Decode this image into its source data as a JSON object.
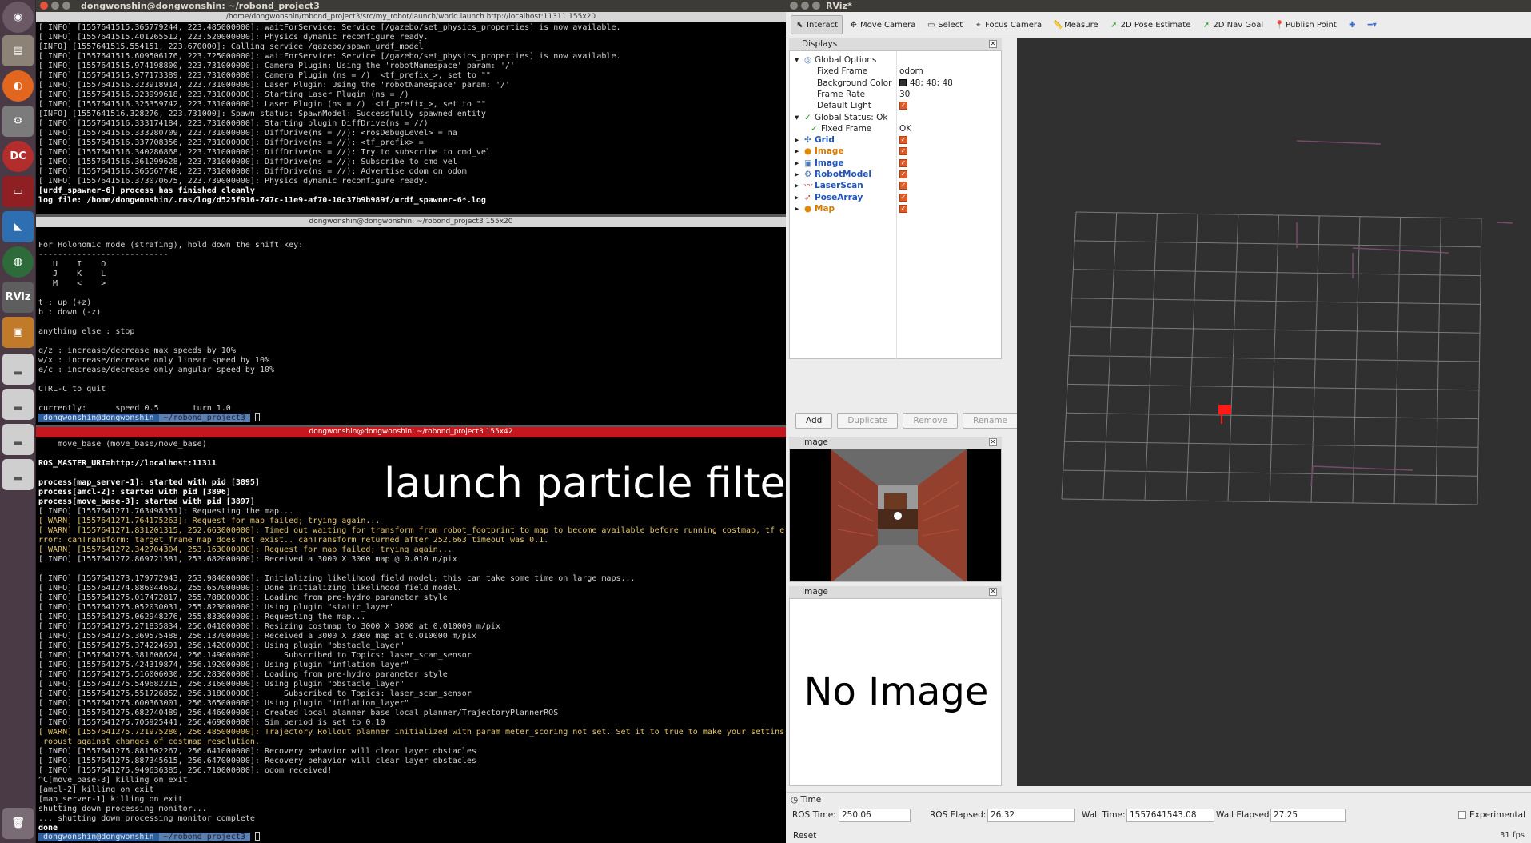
{
  "terminal": {
    "title": "dongwonshin@dongwonshin: ~/robond_project3",
    "pane1_tab": "/home/dongwonshin/robond_project3/src/my_robot/launch/world.launch http://localhost:11311 155x20",
    "pane1_lines": [
      {
        "t": "[ INFO] [1557641515.365779244, 223.485000000]: waitForService: Service [/gazebo/set_physics_properties] is now available.",
        "c": ""
      },
      {
        "t": "[ INFO] [1557641515.401265512, 223.520000000]: Physics dynamic reconfigure ready.",
        "c": ""
      },
      {
        "t": "[INFO] [1557641515.554151, 223.670000]: Calling service /gazebo/spawn_urdf_model",
        "c": ""
      },
      {
        "t": "[ INFO] [1557641515.609506176, 223.725000000]: waitForService: Service [/gazebo/set_physics_properties] is now available.",
        "c": ""
      },
      {
        "t": "[ INFO] [1557641515.974198800, 223.731000000]: Camera Plugin: Using the 'robotNamespace' param: '/'",
        "c": ""
      },
      {
        "t": "[ INFO] [1557641515.977173389, 223.731000000]: Camera Plugin (ns = /)  <tf_prefix_>, set to \"\"",
        "c": ""
      },
      {
        "t": "[ INFO] [1557641516.323918914, 223.731000000]: Laser Plugin: Using the 'robotNamespace' param: '/'",
        "c": ""
      },
      {
        "t": "[ INFO] [1557641516.323999618, 223.731000000]: Starting Laser Plugin (ns = /)",
        "c": ""
      },
      {
        "t": "[ INFO] [1557641516.325359742, 223.731000000]: Laser Plugin (ns = /)  <tf_prefix_>, set to \"\"",
        "c": ""
      },
      {
        "t": "[INFO] [1557641516.328276, 223.731000]: Spawn status: SpawnModel: Successfully spawned entity",
        "c": ""
      },
      {
        "t": "[ INFO] [1557641516.333174184, 223.731000000]: Starting plugin DiffDrive(ns = //)",
        "c": ""
      },
      {
        "t": "[ INFO] [1557641516.333280709, 223.731000000]: DiffDrive(ns = //): <rosDebugLevel> = na",
        "c": ""
      },
      {
        "t": "[ INFO] [1557641516.337708356, 223.731000000]: DiffDrive(ns = //): <tf_prefix> =",
        "c": ""
      },
      {
        "t": "[ INFO] [1557641516.340286868, 223.731000000]: DiffDrive(ns = //): Try to subscribe to cmd_vel",
        "c": ""
      },
      {
        "t": "[ INFO] [1557641516.361299628, 223.731000000]: DiffDrive(ns = //): Subscribe to cmd_vel",
        "c": ""
      },
      {
        "t": "[ INFO] [1557641516.365567748, 223.731000000]: DiffDrive(ns = //): Advertise odom on odom",
        "c": ""
      },
      {
        "t": "[ INFO] [1557641516.373070675, 223.739000000]: Physics dynamic reconfigure ready.",
        "c": ""
      },
      {
        "t": "[urdf_spawner-6] process has finished cleanly",
        "c": "b"
      },
      {
        "t": "log file: /home/dongwonshin/.ros/log/d525f916-747c-11e9-af70-10c37b9b989f/urdf_spawner-6*.log",
        "c": "b"
      }
    ],
    "pane2_tab": "dongwonshin@dongwonshin: ~/robond_project3 155x20",
    "pane2_lines": [
      {
        "t": "For Holonomic mode (strafing), hold down the shift key:",
        "c": ""
      },
      {
        "t": "---------------------------",
        "c": ""
      },
      {
        "t": "   U    I    O",
        "c": ""
      },
      {
        "t": "   J    K    L",
        "c": ""
      },
      {
        "t": "   M    <    >",
        "c": ""
      },
      {
        "t": "",
        "c": ""
      },
      {
        "t": "t : up (+z)",
        "c": ""
      },
      {
        "t": "b : down (-z)",
        "c": ""
      },
      {
        "t": "",
        "c": ""
      },
      {
        "t": "anything else : stop",
        "c": ""
      },
      {
        "t": "",
        "c": ""
      },
      {
        "t": "q/z : increase/decrease max speeds by 10%",
        "c": ""
      },
      {
        "t": "w/x : increase/decrease only linear speed by 10%",
        "c": ""
      },
      {
        "t": "e/c : increase/decrease only angular speed by 10%",
        "c": ""
      },
      {
        "t": "",
        "c": ""
      },
      {
        "t": "CTRL-C to quit",
        "c": ""
      },
      {
        "t": "",
        "c": ""
      },
      {
        "t": "currently:      speed 0.5       turn 1.0",
        "c": ""
      }
    ],
    "prompt_user": " dongwonshin@dongwonshin ",
    "prompt_path": " ~/robond_project3 ",
    "pane3_tab": "dongwonshin@dongwonshin: ~/robond_project3 155x42",
    "pane3_lines": [
      {
        "t": "    move_base (move_base/move_base)",
        "c": ""
      },
      {
        "t": "",
        "c": ""
      },
      {
        "t": "ROS_MASTER_URI=http://localhost:11311",
        "c": "b"
      },
      {
        "t": "",
        "c": ""
      },
      {
        "t": "process[map_server-1]: started with pid [3895]",
        "c": "b"
      },
      {
        "t": "process[amcl-2]: started with pid [3896]",
        "c": "b"
      },
      {
        "t": "process[move_base-3]: started with pid [3897]",
        "c": "b"
      },
      {
        "t": "[ INFO] [1557641271.763498351]: Requesting the map...",
        "c": ""
      },
      {
        "t": "[ WARN] [1557641271.764175263]: Request for map failed; trying again...",
        "c": "w"
      },
      {
        "t": "[ WARN] [1557641271.831201315, 252.663000000]: Timed out waiting for transform from robot_footprint to map to become available before running costmap, tf e",
        "c": "w"
      },
      {
        "t": "rror: canTransform: target_frame map does not exist.. canTransform returned after 252.663 timeout was 0.1.",
        "c": "w"
      },
      {
        "t": "[ WARN] [1557641272.342704304, 253.163000000]: Request for map failed; trying again...",
        "c": "w"
      },
      {
        "t": "[ INFO] [1557641272.869721581, 253.682000000]: Received a 3000 X 3000 map @ 0.010 m/pix",
        "c": ""
      },
      {
        "t": "",
        "c": ""
      },
      {
        "t": "[ INFO] [1557641273.179772943, 253.984000000]: Initializing likelihood field model; this can take some time on large maps...",
        "c": ""
      },
      {
        "t": "[ INFO] [1557641274.886044662, 255.657000000]: Done initializing likelihood field model.",
        "c": ""
      },
      {
        "t": "[ INFO] [1557641275.017472817, 255.788000000]: Loading from pre-hydro parameter style",
        "c": ""
      },
      {
        "t": "[ INFO] [1557641275.052030031, 255.823000000]: Using plugin \"static_layer\"",
        "c": ""
      },
      {
        "t": "[ INFO] [1557641275.062948276, 255.833000000]: Requesting the map...",
        "c": ""
      },
      {
        "t": "[ INFO] [1557641275.271835834, 256.041000000]: Resizing costmap to 3000 X 3000 at 0.010000 m/pix",
        "c": ""
      },
      {
        "t": "[ INFO] [1557641275.369575488, 256.137000000]: Received a 3000 X 3000 map at 0.010000 m/pix",
        "c": ""
      },
      {
        "t": "[ INFO] [1557641275.374224691, 256.142000000]: Using plugin \"obstacle_layer\"",
        "c": ""
      },
      {
        "t": "[ INFO] [1557641275.381608624, 256.149000000]:     Subscribed to Topics: laser_scan_sensor",
        "c": ""
      },
      {
        "t": "[ INFO] [1557641275.424319874, 256.192000000]: Using plugin \"inflation_layer\"",
        "c": ""
      },
      {
        "t": "[ INFO] [1557641275.516006030, 256.283000000]: Loading from pre-hydro parameter style",
        "c": ""
      },
      {
        "t": "[ INFO] [1557641275.549682215, 256.316000000]: Using plugin \"obstacle_layer\"",
        "c": ""
      },
      {
        "t": "[ INFO] [1557641275.551726852, 256.318000000]:     Subscribed to Topics: laser_scan_sensor",
        "c": ""
      },
      {
        "t": "[ INFO] [1557641275.600363001, 256.365000000]: Using plugin \"inflation_layer\"",
        "c": ""
      },
      {
        "t": "[ INFO] [1557641275.682740489, 256.446000000]: Created local_planner base_local_planner/TrajectoryPlannerROS",
        "c": ""
      },
      {
        "t": "[ INFO] [1557641275.705925441, 256.469000000]: Sim period is set to 0.10",
        "c": ""
      },
      {
        "t": "[ WARN] [1557641275.721975280, 256.485000000]: Trajectory Rollout planner initialized with param meter_scoring not set. Set it to true to make your settins",
        "c": "w"
      },
      {
        "t": " robust against changes of costmap resolution.",
        "c": "w"
      },
      {
        "t": "[ INFO] [1557641275.881502267, 256.641000000]: Recovery behavior will clear layer obstacles",
        "c": ""
      },
      {
        "t": "[ INFO] [1557641275.887345615, 256.647000000]: Recovery behavior will clear layer obstacles",
        "c": ""
      },
      {
        "t": "[ INFO] [1557641275.949636385, 256.710000000]: odom received!",
        "c": ""
      },
      {
        "t": "^C[move_base-3] killing on exit",
        "c": ""
      },
      {
        "t": "[amcl-2] killing on exit",
        "c": ""
      },
      {
        "t": "[map_server-1] killing on exit",
        "c": ""
      },
      {
        "t": "shutting down processing monitor...",
        "c": ""
      },
      {
        "t": "... shutting down processing monitor complete",
        "c": ""
      },
      {
        "t": "done",
        "c": "b"
      }
    ],
    "overlay_text": "launch particle filter"
  },
  "rviz": {
    "title": "RViz*",
    "toolbar": [
      {
        "label": "Interact",
        "icon": "cursor-icon",
        "glyph": "⬉",
        "on": true
      },
      {
        "label": "Move Camera",
        "icon": "move-camera-icon",
        "glyph": "✥",
        "on": false
      },
      {
        "label": "Select",
        "icon": "select-icon",
        "glyph": "▭",
        "on": false
      },
      {
        "label": "Focus Camera",
        "icon": "focus-camera-icon",
        "glyph": "⌖",
        "on": false
      },
      {
        "label": "Measure",
        "icon": "measure-icon",
        "glyph": "📏",
        "on": false
      },
      {
        "label": "2D Pose Estimate",
        "icon": "pose-estimate-icon",
        "glyph": "➚",
        "on": false
      },
      {
        "label": "2D Nav Goal",
        "icon": "nav-goal-icon",
        "glyph": "➚",
        "on": false
      },
      {
        "label": "Publish Point",
        "icon": "publish-point-icon",
        "glyph": "📍",
        "on": false
      },
      {
        "label": "",
        "icon": "plus-icon",
        "glyph": "✚",
        "on": false
      },
      {
        "label": "",
        "icon": "minus-dropdown-icon",
        "glyph": "━▾",
        "on": false
      }
    ],
    "displays_title": "Displays",
    "displays": [
      {
        "name": "Global Options",
        "value": "",
        "indent": 0,
        "arrow": "▾",
        "kind": "opt",
        "check": false
      },
      {
        "name": "Fixed Frame",
        "value": "odom",
        "indent": 2,
        "arrow": "",
        "kind": "plain",
        "check": false
      },
      {
        "name": "Background Color",
        "value": "48; 48; 48",
        "indent": 2,
        "arrow": "",
        "kind": "color",
        "check": false
      },
      {
        "name": "Frame Rate",
        "value": "30",
        "indent": 2,
        "arrow": "",
        "kind": "plain",
        "check": false
      },
      {
        "name": "Default Light",
        "value": "",
        "indent": 2,
        "arrow": "",
        "kind": "plain",
        "check": true
      },
      {
        "name": "Global Status: Ok",
        "value": "",
        "indent": 0,
        "arrow": "▾",
        "kind": "ok",
        "check": false
      },
      {
        "name": "Fixed Frame",
        "value": "OK",
        "indent": 1,
        "arrow": "",
        "kind": "okchild",
        "check": false
      },
      {
        "name": "Grid",
        "value": "",
        "indent": 0,
        "arrow": "▸",
        "kind": "blue",
        "check": true
      },
      {
        "name": "Image",
        "value": "",
        "indent": 0,
        "arrow": "▸",
        "kind": "orange",
        "check": true
      },
      {
        "name": "Image",
        "value": "",
        "indent": 0,
        "arrow": "▸",
        "kind": "blue",
        "check": true
      },
      {
        "name": "RobotModel",
        "value": "",
        "indent": 0,
        "arrow": "▸",
        "kind": "blue",
        "check": true
      },
      {
        "name": "LaserScan",
        "value": "",
        "indent": 0,
        "arrow": "▸",
        "kind": "blue",
        "check": true
      },
      {
        "name": "PoseArray",
        "value": "",
        "indent": 0,
        "arrow": "▸",
        "kind": "blue",
        "check": true
      },
      {
        "name": "Map",
        "value": "",
        "indent": 0,
        "arrow": "▸",
        "kind": "orange",
        "check": true
      }
    ],
    "buttons": {
      "add": "Add",
      "duplicate": "Duplicate",
      "remove": "Remove",
      "rename": "Rename"
    },
    "image_panel_1_title": "Image",
    "image_panel_2_title": "Image",
    "no_image_text": "No Image",
    "time_title": "Time",
    "ros_time_label": "ROS Time:",
    "ros_time": "250.06",
    "ros_elapsed_label": "ROS Elapsed:",
    "ros_elapsed": "26.32",
    "wall_time_label": "Wall Time:",
    "wall_time": "1557641543.08",
    "wall_elapsed_label": "Wall Elapsed:",
    "wall_elapsed": "27.25",
    "experimental_label": "Experimental",
    "reset_label": "Reset",
    "fps": "31 fps"
  },
  "colors": {
    "bg_viewport": "#303030",
    "accent_red": "#c7171e",
    "grid": "#7a7a7a"
  }
}
